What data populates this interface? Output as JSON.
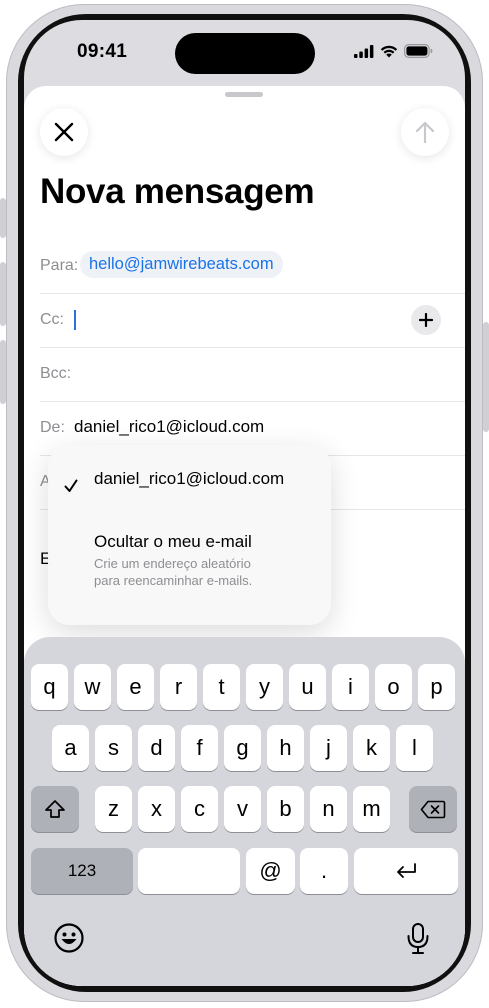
{
  "status_bar": {
    "time": "09:41"
  },
  "compose": {
    "title": "Nova mensagem",
    "to": {
      "label": "Para:",
      "value": "hello@jamwirebeats.com"
    },
    "cc": {
      "label": "Cc:"
    },
    "bcc": {
      "label": "Bcc:"
    },
    "from": {
      "label": "De:",
      "value": "daniel_rico1@icloud.com"
    },
    "hidden_row_initial": "A",
    "body_row_initial": "E"
  },
  "from_menu": {
    "option_email": "daniel_rico1@icloud.com",
    "option_hide_title": "Ocultar o meu e-mail",
    "option_hide_subtitle_1": "Crie um endereço aleatório",
    "option_hide_subtitle_2": "para reencaminhar e-mails."
  },
  "keyboard": {
    "row1": [
      "q",
      "w",
      "e",
      "r",
      "t",
      "y",
      "u",
      "i",
      "o",
      "p"
    ],
    "row2": [
      "a",
      "s",
      "d",
      "f",
      "g",
      "h",
      "j",
      "k",
      "l"
    ],
    "row3": [
      "z",
      "x",
      "c",
      "v",
      "b",
      "n",
      "m"
    ],
    "numbers_key": "123",
    "at_key": "@",
    "dot_key": "."
  },
  "icons": [
    "close-icon",
    "send-arrow-icon",
    "plus-icon",
    "checkmark-icon",
    "shift-icon",
    "backspace-icon",
    "return-icon",
    "emoji-icon",
    "microphone-icon",
    "signal-icon",
    "wifi-icon",
    "battery-icon"
  ]
}
